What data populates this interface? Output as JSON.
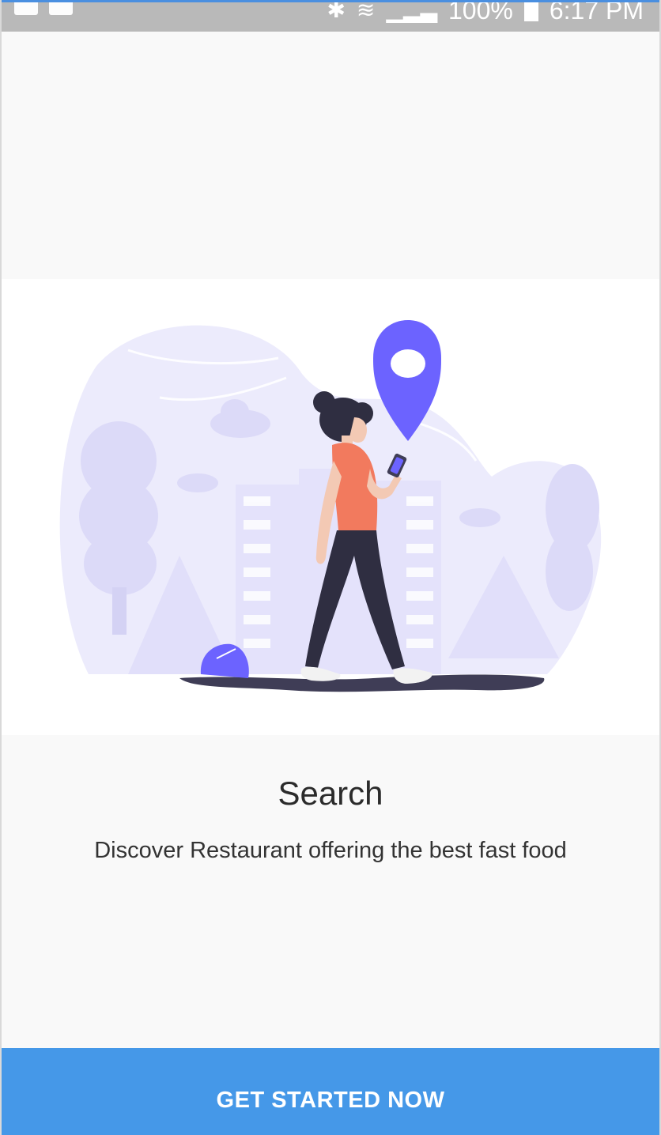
{
  "status_bar": {
    "battery_percent": "100%",
    "time": "6:17 PM",
    "icons": [
      "keyboard-icon",
      "video-icon",
      "bluetooth-icon",
      "wifi-icon",
      "signal-icon",
      "battery-icon"
    ]
  },
  "onboarding": {
    "title": "Search",
    "description": "Discover Restaurant offering the best fast food",
    "illustration": "woman-walking-with-phone-location-pin"
  },
  "cta": {
    "label": "GET STARTED NOW"
  },
  "colors": {
    "accent": "#4598e8",
    "illustration_primary": "#6c63ff",
    "illustration_background": "#ecebfc",
    "shirt": "#f27a5e",
    "dark": "#3f3d56"
  }
}
